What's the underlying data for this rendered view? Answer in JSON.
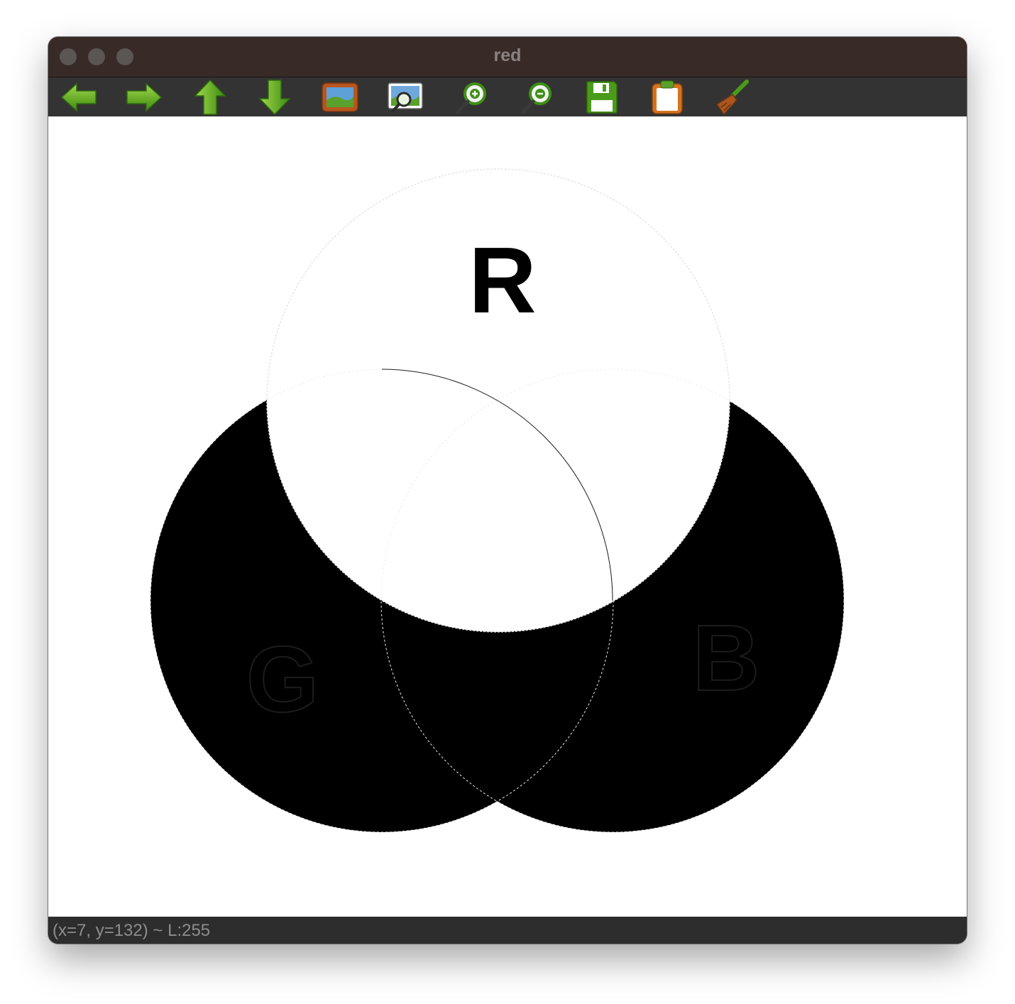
{
  "window": {
    "title": "red"
  },
  "toolbar": {
    "buttons": [
      {
        "name": "pan-left",
        "icon": "arrow-left-icon"
      },
      {
        "name": "pan-right",
        "icon": "arrow-right-icon"
      },
      {
        "name": "pan-up",
        "icon": "arrow-up-icon"
      },
      {
        "name": "pan-down",
        "icon": "arrow-down-icon"
      },
      {
        "name": "fit-image",
        "icon": "picture-icon"
      },
      {
        "name": "zoom-original",
        "icon": "picture-magnifier-icon"
      },
      {
        "name": "zoom-in",
        "icon": "zoom-in-icon"
      },
      {
        "name": "zoom-out",
        "icon": "zoom-out-icon"
      },
      {
        "name": "save",
        "icon": "floppy-disk-icon"
      },
      {
        "name": "copy-to-clipboard",
        "icon": "clipboard-icon"
      },
      {
        "name": "properties",
        "icon": "broom-icon"
      }
    ]
  },
  "image": {
    "labels": {
      "r": "R",
      "g": "G",
      "b": "B"
    },
    "colors": {
      "background": "#ffffff",
      "foreground": "#000000"
    }
  },
  "status": {
    "text": "(x=7, y=132) ~ L:255"
  }
}
